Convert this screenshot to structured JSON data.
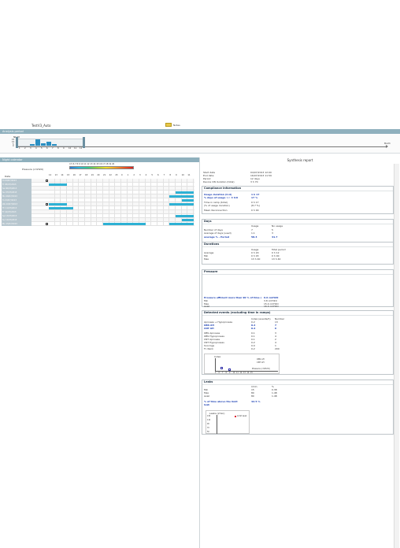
{
  "header": {
    "filename": "TestV3_Auto",
    "notes_label": "Notes"
  },
  "analysis": {
    "title": "Analysis period",
    "axis_y_label": "Nb M",
    "y_ticks": [
      "15",
      "10",
      "5",
      "0"
    ],
    "x_ticks": [
      "1",
      "2",
      "3",
      "4",
      "5",
      "6",
      "7",
      "8",
      "9",
      "10",
      "11",
      "12"
    ],
    "x_end_label": "Month",
    "bars": [
      0,
      0,
      0.3,
      1,
      0.4,
      0.6,
      0.2,
      0,
      0,
      0,
      0,
      0
    ]
  },
  "night": {
    "title": "Night calendar",
    "pressure_label": "Pressure (cmH2O)",
    "scale_numbers": "4  5  6  7  8  9  10 11 12 13 14 15 16 17 18 19 20",
    "date_header": "Date",
    "hours": [
      "12",
      "13",
      "14",
      "15",
      "16",
      "17",
      "18",
      "19",
      "20",
      "21",
      "22",
      "23",
      "0",
      "1",
      "2",
      "3",
      "4",
      "5",
      "6",
      "7",
      "8",
      "9",
      "10",
      "11"
    ],
    "rows": [
      {
        "date": "Tu  09/07/2013"
      },
      {
        "date": "Fr  05/07/2013"
      },
      {
        "date": "Sa  06/07/2013"
      },
      {
        "date": "Su  07/07/2013"
      },
      {
        "date": "Mo  08/07/2013"
      },
      {
        "date": "Tu  09/07/2013"
      },
      {
        "date": "We  10/07/2013"
      },
      {
        "date": "Th  11/07/2013"
      },
      {
        "date": "Fr  12/07/2013"
      },
      {
        "date": "Sa  13/07/2013"
      },
      {
        "date": "Su  14/07/2013"
      },
      {
        "date": "Mo  15/07/2013"
      }
    ]
  },
  "report": {
    "title": "Synthesis report",
    "info": [
      {
        "label": "Start date",
        "value": "04/07/2013 12:00"
      },
      {
        "label": "End date",
        "value": "16/07/2013 11:59"
      },
      {
        "label": "Period",
        "value": "12 days"
      },
      {
        "label": "Device ON duration (total)",
        "value": "3 h 70"
      }
    ],
    "compliance": {
      "title": "Compliance information",
      "rows": [
        {
          "label": "Usage duration (h:d)",
          "value": "1 h 17"
        },
        {
          "label": "% days of usage >= 4 h:0",
          "value": "17 %"
        },
        {
          "label": "Time in ramp (total)",
          "value": "0 h 17"
        },
        {
          "label": "(% of usage duration)",
          "value": "(8.7 %)"
        },
        {
          "label": "Mask disconnection",
          "value": "0 h 00"
        }
      ]
    },
    "days": {
      "title": "Days",
      "col1": "Usage",
      "col2": "No usage",
      "rows": [
        {
          "label": "Number of days",
          "v1": "7",
          "v2": "5"
        },
        {
          "label": "Average of days (used)",
          "v1": "1.1",
          "v2": "3"
        },
        {
          "label": "average % - Period",
          "v1": "58.3",
          "v2": "41.7"
        }
      ]
    },
    "durations": {
      "title": "Durations",
      "col1": "Usage",
      "col2": "Total period",
      "rows": [
        {
          "label": "Average",
          "v1": "0 h 20",
          "v2": "0 h 12"
        },
        {
          "label": "Min",
          "v1": "0 h 03",
          "v2": "0 h 00"
        },
        {
          "label": "Max",
          "v1": "13 h 40",
          "v2": "13 h 40"
        }
      ]
    },
    "pressure": {
      "title": "Pressure",
      "rows": [
        {
          "label": "Pressure efficient more than 90 % of time (",
          "value": "6.0 cmH2O"
        },
        {
          "label": "Min",
          "value": "3.8 cmH2O"
        },
        {
          "label": "Max",
          "value": "15.0 cmH2O"
        },
        {
          "label": "Avail",
          "value": "16.0 cmH2O"
        }
      ]
    },
    "events": {
      "title": "Detected events (excluding time in ramps)",
      "col1": "Index (events/h)",
      "col2": "Number",
      "rows": [
        {
          "label": "Apnoeas + Hypopnoeas",
          "v1": "0.2",
          "v2": "13"
        },
        {
          "label": "OBS AH",
          "v1": "0.2",
          "v2": "7"
        },
        {
          "label": "CNT AH",
          "v1": "0.2",
          "v2": "6"
        },
        {
          "label": "OBS Apnoeas",
          "v1": "0.1",
          "v2": "3"
        },
        {
          "label": "OBS Hypopnoeas",
          "v1": "0.1",
          "v2": "4"
        },
        {
          "label": "CNT Apnoeas",
          "v1": "0.1",
          "v2": "2"
        },
        {
          "label": "CNT Hypopnoeas",
          "v1": "0.2",
          "v2": "4"
        },
        {
          "label": "Snorings",
          "v1": "0.0",
          "v2": "1"
        },
        {
          "label": "Fl. Rank",
          "v1": "0.2",
          "v2": "200"
        }
      ],
      "chart_ylabel": "Index",
      "chart_xlabel": "Pressure (cmH2O)",
      "chart_legend": [
        "OBS AH",
        "CNT AH"
      ],
      "chart_xticks": [
        "4",
        "6",
        "7",
        "8",
        "9",
        "10",
        "11",
        "12",
        "13",
        "14",
        "15"
      ]
    },
    "leaks": {
      "title": "Leaks",
      "col1": "l/min",
      "col2": "%",
      "rows": [
        {
          "label": "Min",
          "v1": "15",
          "v2": "0.38"
        },
        {
          "label": "Max",
          "v1": "80",
          "v2": "1.48"
        },
        {
          "label": "Avail",
          "v1": "80",
          "v2": "1.48"
        }
      ],
      "over_label": "% of time above the limit leak",
      "over_value": "42.5 %",
      "chart_title": "Leaks (l/min)",
      "chart_legend": "Limit leak",
      "chart_yticks": [
        "130",
        "110",
        "90",
        "70",
        "50"
      ]
    }
  }
}
